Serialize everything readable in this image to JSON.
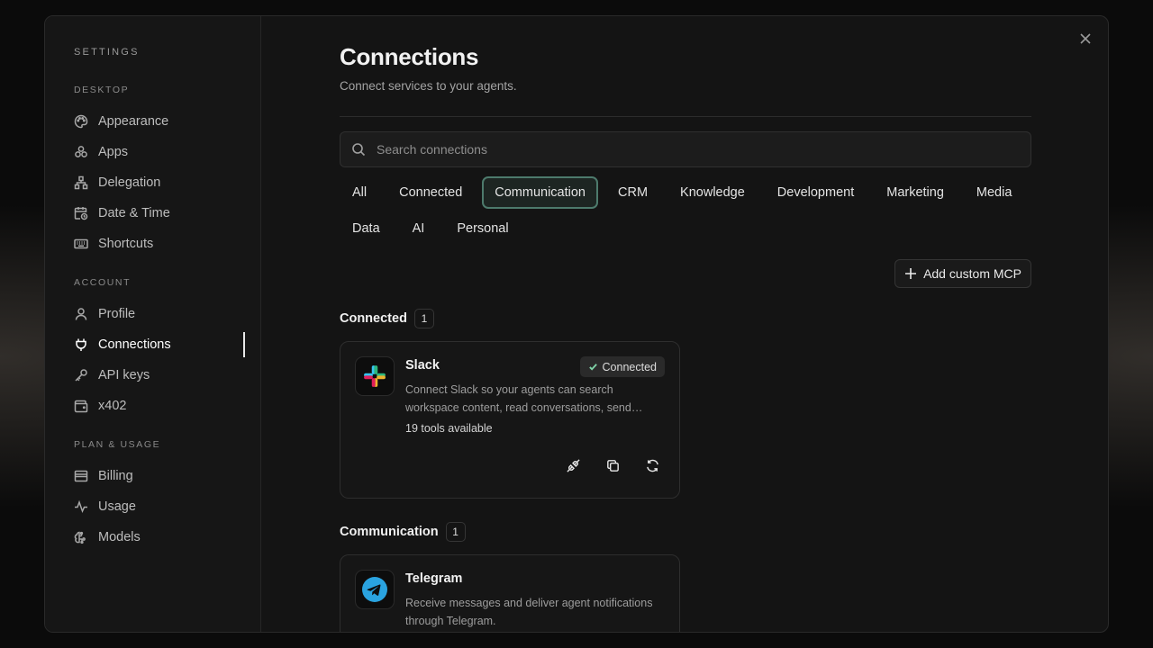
{
  "sidebar": {
    "title": "SETTINGS",
    "groups": [
      {
        "label": "DESKTOP",
        "items": [
          "Appearance",
          "Apps",
          "Delegation",
          "Date & Time",
          "Shortcuts"
        ]
      },
      {
        "label": "ACCOUNT",
        "items": [
          "Profile",
          "Connections",
          "API keys",
          "x402"
        ]
      },
      {
        "label": "PLAN & USAGE",
        "items": [
          "Billing",
          "Usage",
          "Models"
        ]
      }
    ],
    "active_item": "Connections"
  },
  "main": {
    "title": "Connections",
    "subtitle": "Connect services to your agents.",
    "search": {
      "placeholder": "Search connections",
      "value": ""
    },
    "filters": [
      "All",
      "Connected",
      "Communication",
      "CRM",
      "Knowledge",
      "Development",
      "Marketing",
      "Media",
      "Data",
      "AI",
      "Personal"
    ],
    "active_filter": "Communication",
    "add_button_label": "Add custom MCP",
    "sections": [
      {
        "title": "Connected",
        "count": "1",
        "cards": [
          {
            "name": "Slack",
            "status": "Connected",
            "description": "Connect Slack so your agents can search workspace content, read conversations, send…",
            "tools": "19 tools available"
          }
        ]
      },
      {
        "title": "Communication",
        "count": "1",
        "cards": [
          {
            "name": "Telegram",
            "description": "Receive messages and deliver agent notifications through Telegram."
          }
        ]
      }
    ]
  },
  "colors": {
    "accent_border": "#4d7a6c",
    "connected_check": "#7fd3a8",
    "telegram_blue": "#2aa3e0"
  }
}
